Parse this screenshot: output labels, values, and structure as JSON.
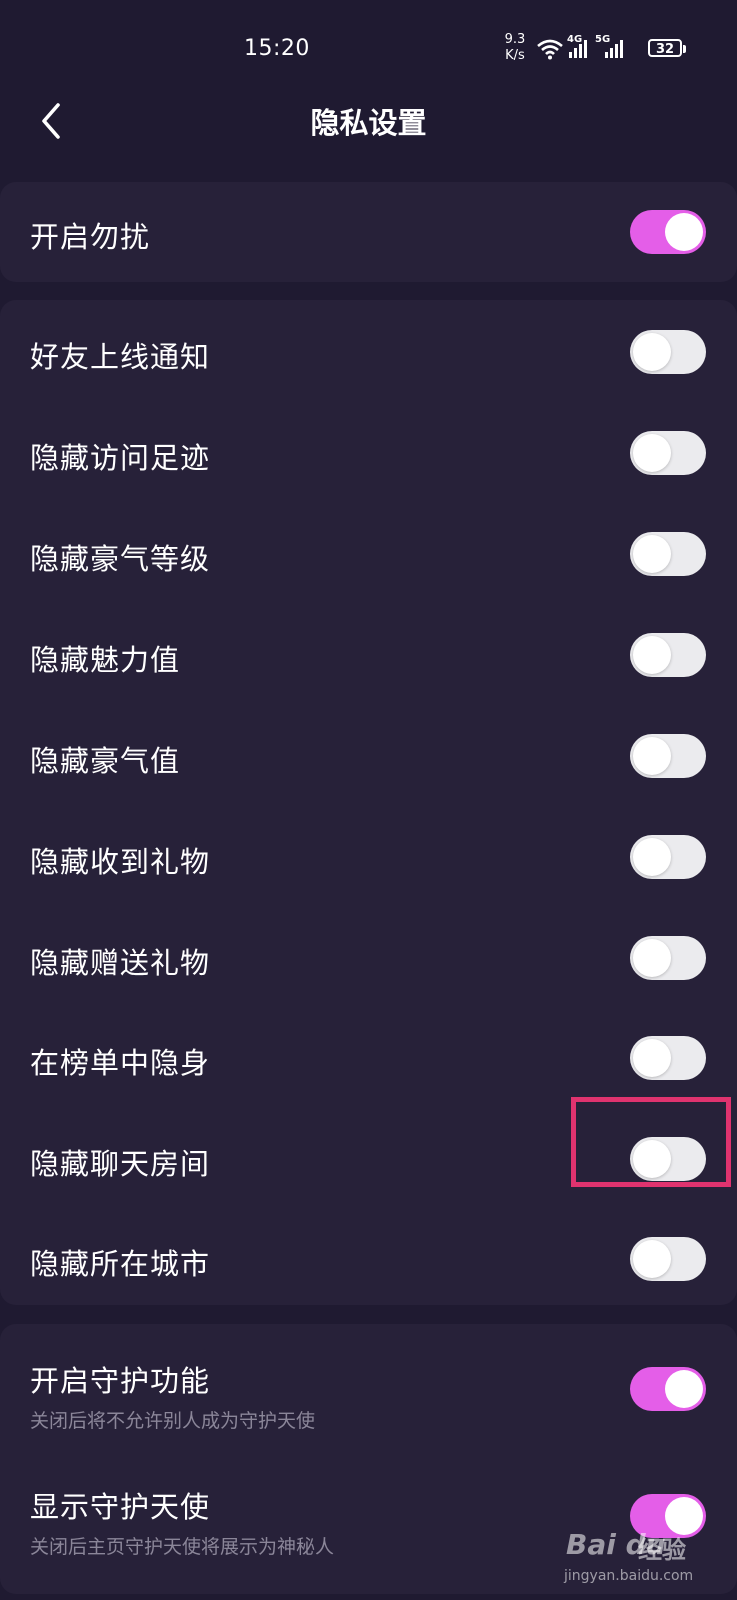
{
  "status_bar": {
    "time": "15:20",
    "net_speed_value": "9.3",
    "net_speed_unit": "K/s",
    "signal1_label": "4G",
    "signal2_label": "5G",
    "battery": "32"
  },
  "header": {
    "title": "隐私设置",
    "back_icon": "chevron-left-icon"
  },
  "groups": [
    {
      "items": [
        {
          "label": "开启勿扰",
          "on": true
        }
      ]
    },
    {
      "items": [
        {
          "label": "好友上线通知",
          "on": false
        },
        {
          "label": "隐藏访问足迹",
          "on": false
        },
        {
          "label": "隐藏豪气等级",
          "on": false
        },
        {
          "label": "隐藏魅力值",
          "on": false
        },
        {
          "label": "隐藏豪气值",
          "on": false
        },
        {
          "label": "隐藏收到礼物",
          "on": false
        },
        {
          "label": "隐藏赠送礼物",
          "on": false
        },
        {
          "label": "在榜单中隐身",
          "on": false
        },
        {
          "label": "隐藏聊天房间",
          "on": false
        },
        {
          "label": "隐藏所在城市",
          "on": false
        }
      ]
    },
    {
      "items": [
        {
          "label": "开启守护功能",
          "subtitle": "关闭后将不允许别人成为守护天使",
          "on": true
        },
        {
          "label": "显示守护天使",
          "subtitle": "关闭后主页守护天使将展示为神秘人",
          "on": true
        }
      ]
    }
  ],
  "watermark": {
    "logo": "Bai du",
    "text": "经验",
    "url": "jingyan.baidu.com"
  },
  "colors": {
    "background": "#1f1a31",
    "card": "#272139",
    "switch_on": "#e45ee8",
    "switch_off": "#ebebee",
    "highlight": "#e0336f"
  }
}
